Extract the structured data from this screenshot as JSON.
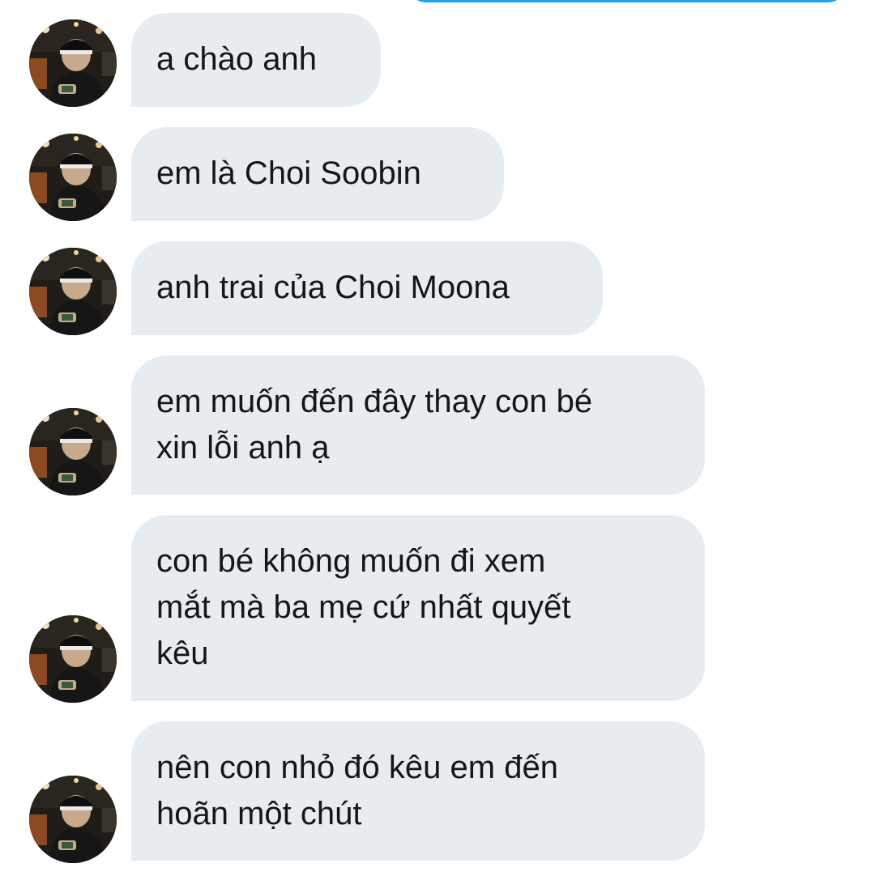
{
  "conversation": {
    "messages": [
      {
        "lines": [
          "a chào anh"
        ]
      },
      {
        "lines": [
          "em là Choi Soobin"
        ]
      },
      {
        "lines": [
          "anh trai của Choi Moona"
        ]
      },
      {
        "lines": [
          "em muốn đến đây thay con bé",
          "xin lỗi anh ạ"
        ]
      },
      {
        "lines": [
          "con bé không muốn đi xem",
          "mắt mà ba mẹ cứ nhất quyết",
          "kêu"
        ]
      },
      {
        "lines": [
          "nên con nhỏ đó kêu em đến",
          "hoãn một chút"
        ]
      }
    ]
  },
  "sender": {
    "avatar_icon": "profile-photo-avatar"
  },
  "colors": {
    "bubble_background": "#e6ecf0",
    "text": "#14171a",
    "accent": "#1da1f2"
  }
}
